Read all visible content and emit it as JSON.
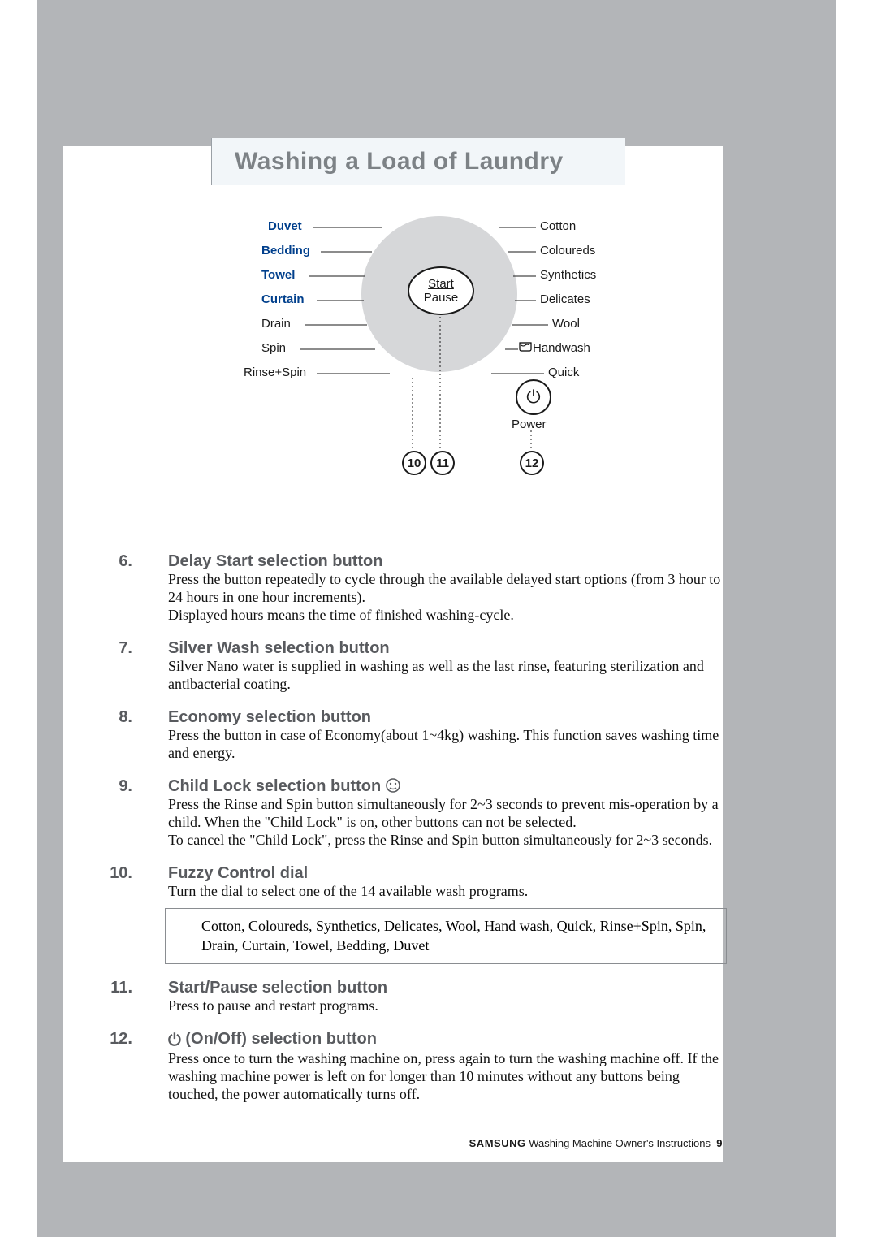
{
  "title": "Washing a Load of Laundry",
  "dial": {
    "left": [
      "Duvet",
      "Bedding",
      "Towel",
      "Curtain",
      "Drain",
      "Spin",
      "Rinse+Spin"
    ],
    "right": [
      "Cotton",
      "Coloureds",
      "Synthetics",
      "Delicates",
      "Wool",
      "Handwash",
      "Quick"
    ],
    "center_top": "Start",
    "center_bottom": "Pause",
    "power": "Power",
    "callouts": {
      "c10": "10",
      "c11": "11",
      "c12": "12"
    }
  },
  "items": [
    {
      "n": "6.",
      "title": "Delay Start selection button",
      "body": "Press the button repeatedly to cycle through the available delayed start options (from 3 hour to 24 hours in one hour increments).\nDisplayed hours means the time of finished washing-cycle."
    },
    {
      "n": "7.",
      "title": "Silver Wash selection button",
      "body": "Silver Nano water is supplied in washing as well as the last rinse, featuring sterilization and antibacterial coating."
    },
    {
      "n": "8.",
      "title": "Economy selection button",
      "body": "Press the button in case of Economy(about 1~4kg) washing. This function saves washing time and energy."
    },
    {
      "n": "9.",
      "title": "Child Lock selection button",
      "icon": "child-lock-icon",
      "body": "Press the Rinse and Spin button simultaneously for 2~3 seconds to prevent mis-operation by a child.  When the \"Child Lock\" is on, other buttons can not be selected.\nTo cancel the \"Child Lock\", press the Rinse and Spin button simultaneously for 2~3 seconds."
    },
    {
      "n": "10.",
      "title": "Fuzzy Control dial",
      "body": "Turn the dial to select one of the 14 available wash programs.",
      "box": "Cotton, Coloureds, Synthetics, Delicates, Wool, Hand wash, Quick, Rinse+Spin, Spin, Drain, Curtain, Towel, Bedding, Duvet"
    },
    {
      "n": "11.",
      "title": "Start/Pause selection button",
      "body": "Press to pause and restart programs."
    },
    {
      "n": "12.",
      "title": "(On/Off) selection button",
      "icon": "power-icon",
      "body": "Press once to turn the washing machine on, press again to turn the washing machine off.  If the washing machine power is left on for longer than 10 minutes without any buttons being touched, the power automatically turns off."
    }
  ],
  "footer": {
    "brand": "SAMSUNG",
    "text": " Washing Machine Owner's Instructions",
    "page": "9"
  }
}
